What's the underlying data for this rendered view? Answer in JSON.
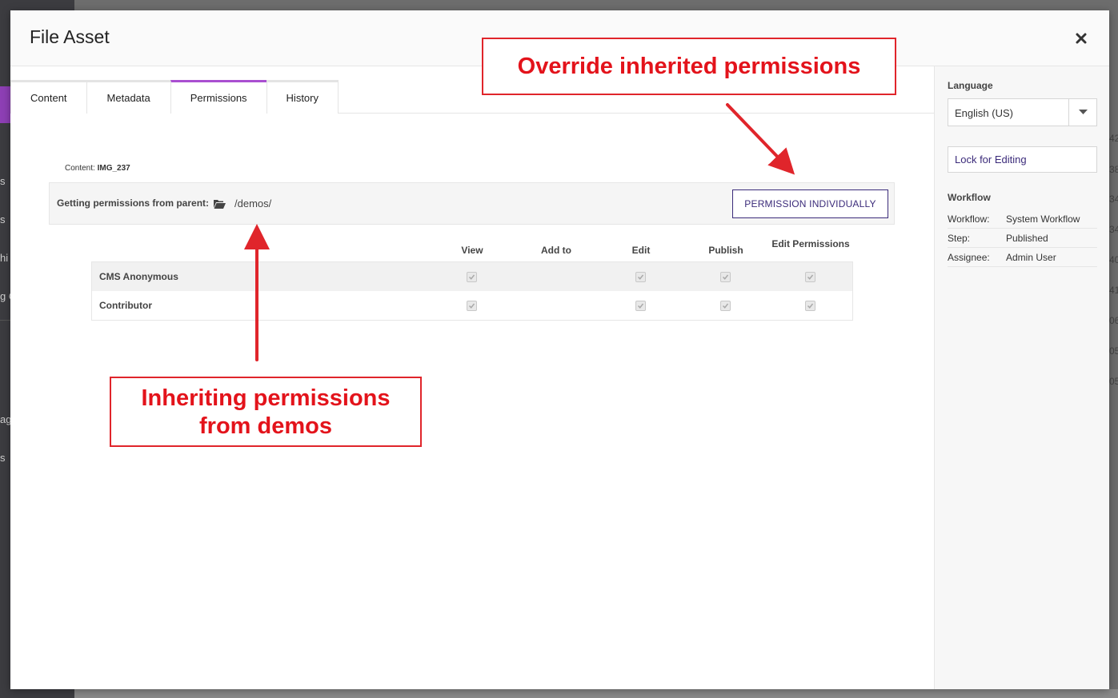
{
  "background": {
    "left_fragments": [
      "s",
      "s",
      "hi",
      "g O",
      "ag",
      "s"
    ],
    "right_fragments": [
      "42",
      "38",
      "34",
      "34",
      "40",
      "41",
      "06",
      "05",
      "05"
    ]
  },
  "modal": {
    "title": "File Asset",
    "close_icon": "close-icon"
  },
  "tabs": [
    {
      "label": "Content",
      "active": false
    },
    {
      "label": "Metadata",
      "active": false
    },
    {
      "label": "Permissions",
      "active": true
    },
    {
      "label": "History",
      "active": false
    }
  ],
  "content": {
    "prefix": "Content:",
    "name": "IMG_237"
  },
  "parent": {
    "label": "Getting permissions from parent:",
    "icon": "folder-open-icon",
    "path": "/demos/",
    "button_label": "PERMISSION INDIVIDUALLY"
  },
  "permissions": {
    "columns": [
      "View",
      "Add to",
      "Edit",
      "Publish",
      "Edit Permissions"
    ],
    "rows": [
      {
        "role": "CMS Anonymous",
        "checked": [
          true,
          false,
          true,
          true,
          true
        ]
      },
      {
        "role": "Contributor",
        "checked": [
          true,
          false,
          true,
          true,
          true
        ]
      }
    ]
  },
  "sidebar": {
    "language_heading": "Language",
    "language_value": "English (US)",
    "lock_button": "Lock for Editing",
    "workflow_heading": "Workflow",
    "workflow": [
      {
        "key": "Workflow:",
        "value": "System Workflow"
      },
      {
        "key": "Step:",
        "value": "Published"
      },
      {
        "key": "Assignee:",
        "value": "Admin User"
      }
    ]
  },
  "annotations": {
    "override": "Override inherited permissions",
    "inherit_line1": "Inheriting permissions",
    "inherit_line2": "from demos",
    "color": "#e3131b"
  },
  "colors": {
    "accent": "#a94fd1",
    "button_text": "#3b2b7a"
  }
}
